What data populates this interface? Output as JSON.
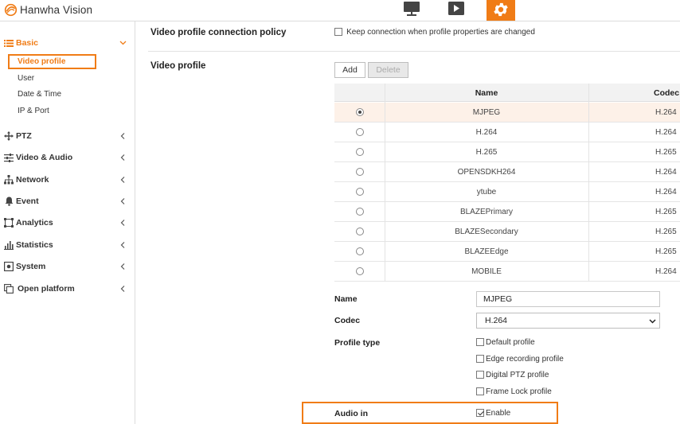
{
  "header": {
    "brand": "Hanwha Vision",
    "icons": [
      "monitor-icon",
      "play-icon",
      "gear-icon"
    ],
    "accent_color": "#f07c16"
  },
  "sidebar": {
    "sections": [
      {
        "label": "Basic",
        "icon": "list-icon",
        "expanded": true,
        "items": [
          "Video profile",
          "User",
          "Date & Time",
          "IP & Port"
        ]
      },
      {
        "label": "PTZ",
        "icon": "move-icon"
      },
      {
        "label": "Video & Audio",
        "icon": "sliders-icon"
      },
      {
        "label": "Network",
        "icon": "network-icon"
      },
      {
        "label": "Event",
        "icon": "bell-icon"
      },
      {
        "label": "Analytics",
        "icon": "analytics-icon"
      },
      {
        "label": "Statistics",
        "icon": "bar-chart-icon"
      },
      {
        "label": "System",
        "icon": "system-icon"
      },
      {
        "label": "Open platform",
        "icon": "platform-icon"
      }
    ]
  },
  "main": {
    "policy": {
      "title": "Video profile connection policy",
      "checkbox_label": "Keep connection when profile properties are changed",
      "checked": false
    },
    "profile": {
      "title": "Video profile",
      "add_label": "Add",
      "delete_label": "Delete",
      "columns": [
        "Name",
        "Codec"
      ],
      "rows": [
        {
          "name": "MJPEG",
          "codec": "H.264",
          "selected": true
        },
        {
          "name": "H.264",
          "codec": "H.264",
          "selected": false
        },
        {
          "name": "H.265",
          "codec": "H.265",
          "selected": false
        },
        {
          "name": "OPENSDKH264",
          "codec": "H.264",
          "selected": false
        },
        {
          "name": "ytube",
          "codec": "H.264",
          "selected": false
        },
        {
          "name": "BLAZEPrimary",
          "codec": "H.265",
          "selected": false
        },
        {
          "name": "BLAZESecondary",
          "codec": "H.265",
          "selected": false
        },
        {
          "name": "BLAZEEdge",
          "codec": "H.265",
          "selected": false
        },
        {
          "name": "MOBILE",
          "codec": "H.264",
          "selected": false
        }
      ]
    },
    "form": {
      "name_label": "Name",
      "name_value": "MJPEG",
      "codec_label": "Codec",
      "codec_value": "H.264",
      "profile_type_label": "Profile type",
      "profile_types": [
        {
          "label": "Default profile",
          "checked": false
        },
        {
          "label": "Edge recording profile",
          "checked": false
        },
        {
          "label": "Digital PTZ profile",
          "checked": false
        },
        {
          "label": "Frame Lock profile",
          "checked": false
        }
      ],
      "audio_in_label": "Audio in",
      "audio_in_option": "Enable",
      "audio_in_checked": true
    }
  }
}
